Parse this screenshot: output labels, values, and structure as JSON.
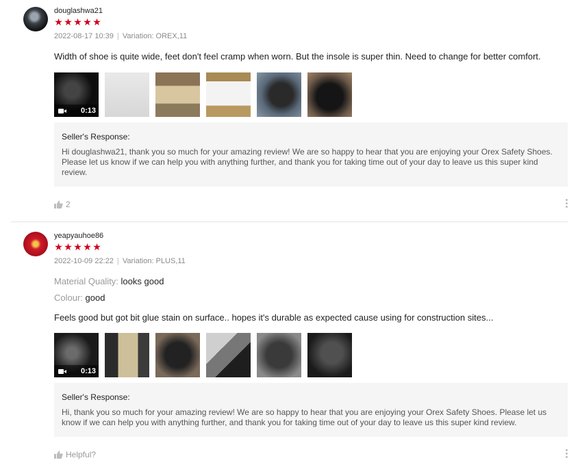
{
  "reviews": [
    {
      "username": "douglashwa21",
      "rating_stars": 5,
      "stars": [
        "★",
        "★",
        "★",
        "★",
        "★"
      ],
      "datetime": "2022-08-17 10:39",
      "separator": "|",
      "variation": "Variation: OREX,11",
      "comment": "Width of shoe is quite wide, feet don't feel cramp when worn.  But the insole is super thin. Need to change for better comfort.",
      "video_duration": "0:13",
      "media_count": 6,
      "seller_response_title": "Seller's Response:",
      "seller_response_text": "Hi douglashwa21, thank you so much for your amazing review! We are so happy to hear that you are enjoying your Orex Safety Shoes. Please let us know if we can help you with anything further, and thank you for taking time out of your day to leave us this super kind review.",
      "helpful_label": "2"
    },
    {
      "username": "yeapyauhoe86",
      "rating_stars": 5,
      "stars": [
        "★",
        "★",
        "★",
        "★",
        "★"
      ],
      "datetime": "2022-10-09 22:22",
      "separator": "|",
      "variation": "Variation: PLUS,11",
      "attributes": [
        {
          "key": "Material Quality:",
          "value": "looks good"
        },
        {
          "key": "Colour:",
          "value": "good"
        }
      ],
      "comment": "Feels good but got bit glue stain on surface.. hopes it's durable as expected cause using for construction sites...",
      "video_duration": "0:13",
      "media_count": 6,
      "seller_response_title": "Seller's Response:",
      "seller_response_text": "Hi, thank you so much for your amazing review! We are so happy to hear that you are enjoying your Orex Safety Shoes. Please let us know if we can help you with anything further, and thank you for taking time out of your day to leave us this super kind review.",
      "helpful_label": "Helpful?"
    }
  ],
  "colors": {
    "star": "#d0011b",
    "muted_text": "#8a8a8a",
    "response_bg": "#f5f5f5",
    "divider": "#e5e5e5"
  },
  "icons": {
    "helpful": "thumbs-up-icon",
    "more": "more-vertical-icon",
    "video": "video-camera-icon"
  }
}
